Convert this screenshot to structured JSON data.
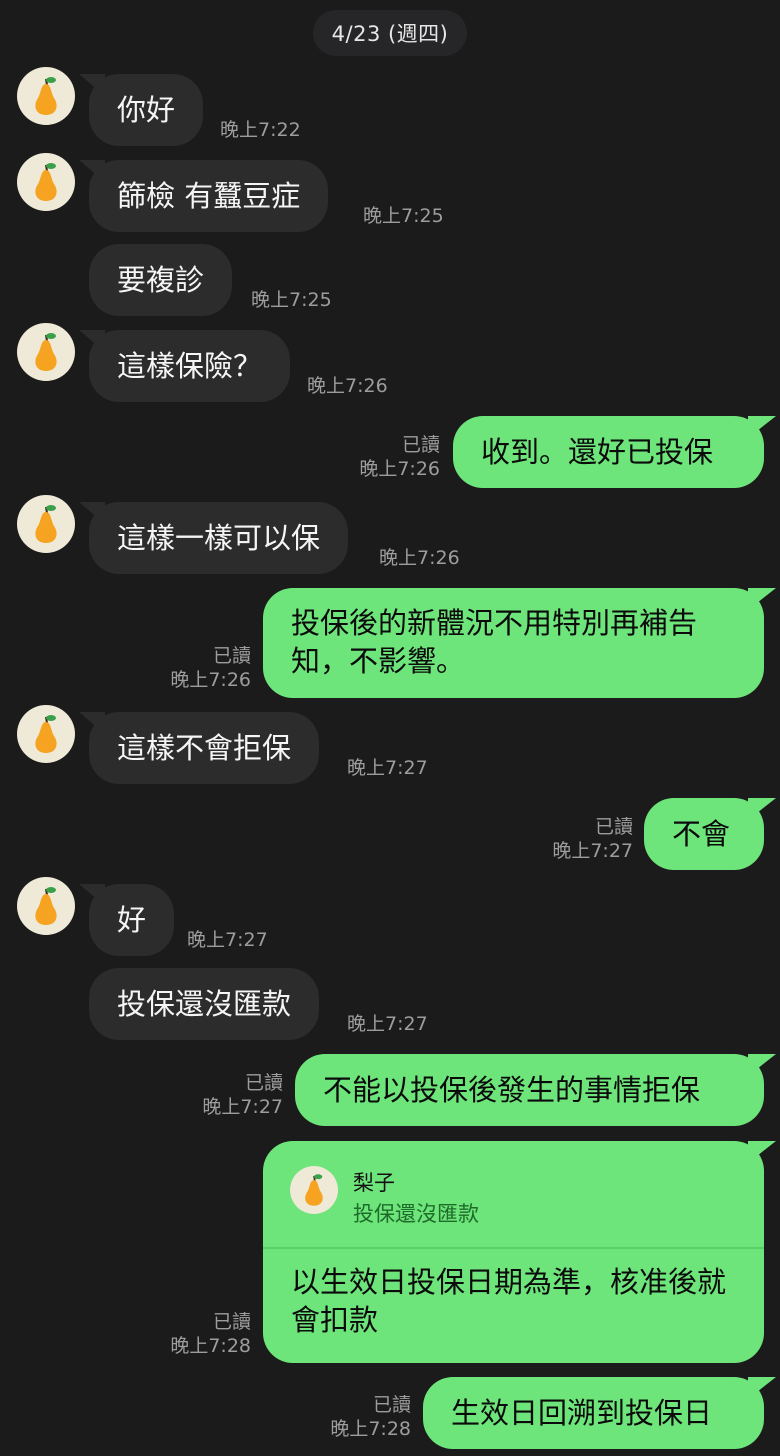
{
  "date_label": "4/23 (週四)",
  "colors": {
    "background": "#1b1b1c",
    "incoming_bubble": "#2c2c2d",
    "outgoing_bubble": "#6de57a",
    "timestamp": "#9d9d9d"
  },
  "contact": {
    "name": "梨子",
    "avatar_icon": "pear-icon"
  },
  "messages": [
    {
      "dir": "in",
      "text": "你好",
      "time": "晚上7:22"
    },
    {
      "dir": "in",
      "text": "篩檢 有蠶豆症",
      "time": "晚上7:25"
    },
    {
      "dir": "in",
      "text": "要複診",
      "time": "晚上7:25"
    },
    {
      "dir": "in",
      "text": "這樣保險？",
      "time": "晚上7:26"
    },
    {
      "dir": "out",
      "text": "收到。還好已投保",
      "read": "已讀",
      "time": "晚上7:26"
    },
    {
      "dir": "in",
      "text": "這樣一樣可以保",
      "time": "晚上7:26"
    },
    {
      "dir": "out",
      "text": "投保後的新體況不用特別再補告知，不影響。",
      "read": "已讀",
      "time": "晚上7:26"
    },
    {
      "dir": "in",
      "text": "這樣不會拒保",
      "time": "晚上7:27"
    },
    {
      "dir": "out",
      "text": "不會",
      "read": "已讀",
      "time": "晚上7:27"
    },
    {
      "dir": "in",
      "text": "好",
      "time": "晚上7:27"
    },
    {
      "dir": "in",
      "text": "投保還沒匯款",
      "time": "晚上7:27"
    },
    {
      "dir": "out",
      "text": "不能以投保後發生的事情拒保",
      "read": "已讀",
      "time": "晚上7:27"
    },
    {
      "dir": "out",
      "reply_to": {
        "name": "梨子",
        "text": "投保還沒匯款"
      },
      "text": "以生效日投保日期為準，核准後就會扣款",
      "read": "已讀",
      "time": "晚上7:28"
    },
    {
      "dir": "out",
      "text": "生效日回溯到投保日",
      "read": "已讀",
      "time": "晚上7:28"
    }
  ]
}
